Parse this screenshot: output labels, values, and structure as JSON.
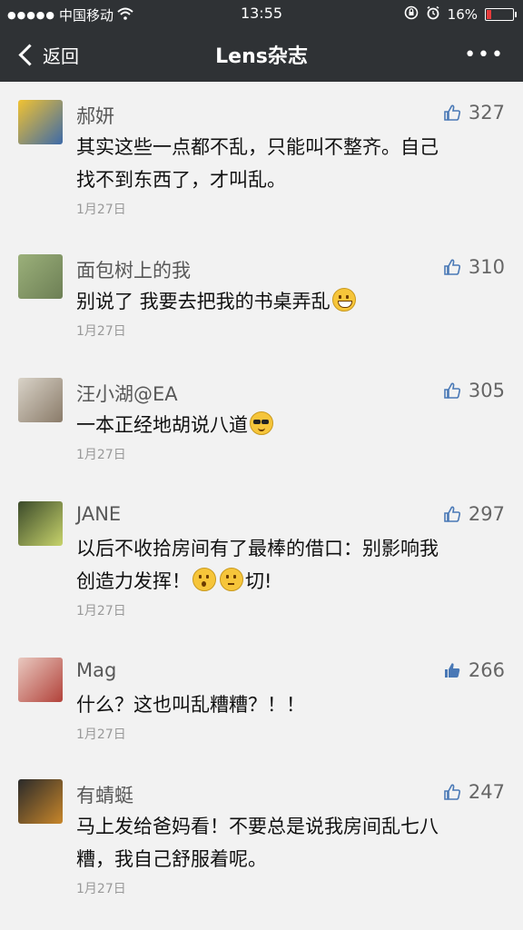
{
  "status_bar": {
    "carrier": "中国移动",
    "time": "13:55",
    "battery": "16%",
    "battery_fill": 0.16
  },
  "nav": {
    "back_label": "返回",
    "title": "Lens杂志",
    "more_label": "•••"
  },
  "comments": [
    {
      "name": "郝妍",
      "likes": "327",
      "text_lines": [
        "其实这些一点都不乱，只能叫不整齐。自己",
        "找不到东西了，才叫乱。"
      ],
      "date": "1月27日",
      "avatar_colors": [
        "#f1c232",
        "#3d6aa8"
      ]
    },
    {
      "name": "面包树上的我",
      "likes": "310",
      "text_lines": [
        "别说了 我要去把我的书桌弄乱"
      ],
      "emojis": [
        "grin"
      ],
      "date": "1月27日",
      "avatar_colors": [
        "#9bb07a",
        "#6d7f55"
      ]
    },
    {
      "name": "汪小湖@EA",
      "likes": "305",
      "text_lines": [
        "一本正经地胡说八道"
      ],
      "emojis": [
        "cool"
      ],
      "date": "1月27日",
      "avatar_colors": [
        "#d9d3c8",
        "#8a7b69"
      ]
    },
    {
      "name": "JANE",
      "likes": "297",
      "text_lines": [
        "以后不收拾房间有了最棒的借口：别影响我",
        "创造力发挥！"
      ],
      "line2_suffix": "切!",
      "emojis": [
        "wow",
        "think"
      ],
      "date": "1月27日",
      "avatar_colors": [
        "#3b4a2a",
        "#c7d36b"
      ]
    },
    {
      "name": "Mag",
      "likes": "266",
      "text_lines": [
        "什么？这也叫乱糟糟？！！"
      ],
      "date": "1月27日",
      "avatar_colors": [
        "#e9c9c0",
        "#b2423a"
      ]
    },
    {
      "name": "有蜻蜓",
      "likes": "247",
      "text_lines": [
        "马上发给爸妈看！不要总是说我房间乱七八",
        "糟，我自己舒服着呢。"
      ],
      "date": "1月27日",
      "avatar_colors": [
        "#2a2a2a",
        "#c8862a"
      ]
    }
  ]
}
